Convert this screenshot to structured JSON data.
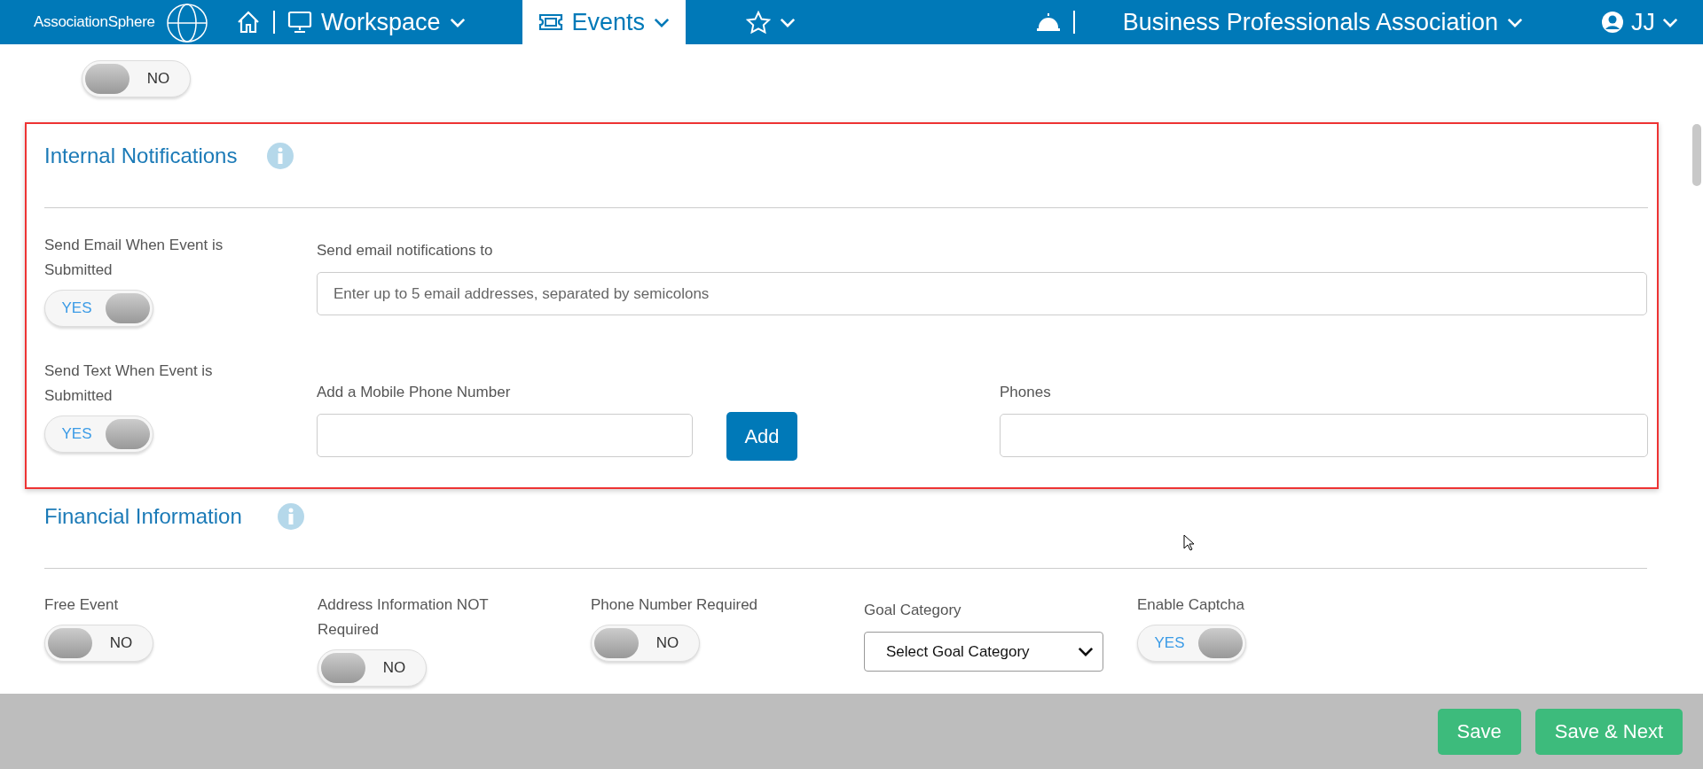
{
  "nav": {
    "logo": "AssociationSphere",
    "menus": [
      {
        "kind": "home",
        "label": "Workspace",
        "selected": false
      },
      {
        "kind": "events",
        "label": "Events",
        "selected": true
      },
      {
        "kind": "favorites",
        "selected": false
      }
    ],
    "organization": "Business Professionals Association",
    "user": "JJ"
  },
  "top_toggle": {
    "on": false,
    "text": "NO"
  },
  "internal_notifications": {
    "title": "Internal Notifications",
    "email_row": {
      "label": "Send Email When Event is Submitted",
      "toggle": {
        "on": true,
        "text": "YES"
      },
      "field_label": "Send email notifications to",
      "placeholder": "Enter up to 5 email addresses, separated by semicolons"
    },
    "text_row": {
      "label": "Send Text When Event is Submitted",
      "toggle": {
        "on": true,
        "text": "YES"
      },
      "field_label": "Add a Mobile Phone Number",
      "add_button": "Add",
      "phones_label": "Phones"
    }
  },
  "financial_information": {
    "title": "Financial Information",
    "fields": [
      {
        "kind": "toggle",
        "label": "Free Event",
        "on": false,
        "text": "NO"
      },
      {
        "kind": "toggle",
        "label": "Address Information NOT Required",
        "on": false,
        "text": "NO"
      },
      {
        "kind": "toggle",
        "label": "Phone Number Required",
        "on": false,
        "text": "NO"
      },
      {
        "kind": "select",
        "label": "Goal Category",
        "value": "Select Goal Category"
      },
      {
        "kind": "toggle",
        "label": "Enable Captcha",
        "on": true,
        "text": "YES"
      }
    ]
  },
  "footer": {
    "buttons": [
      "Save",
      "Save & Next"
    ]
  }
}
